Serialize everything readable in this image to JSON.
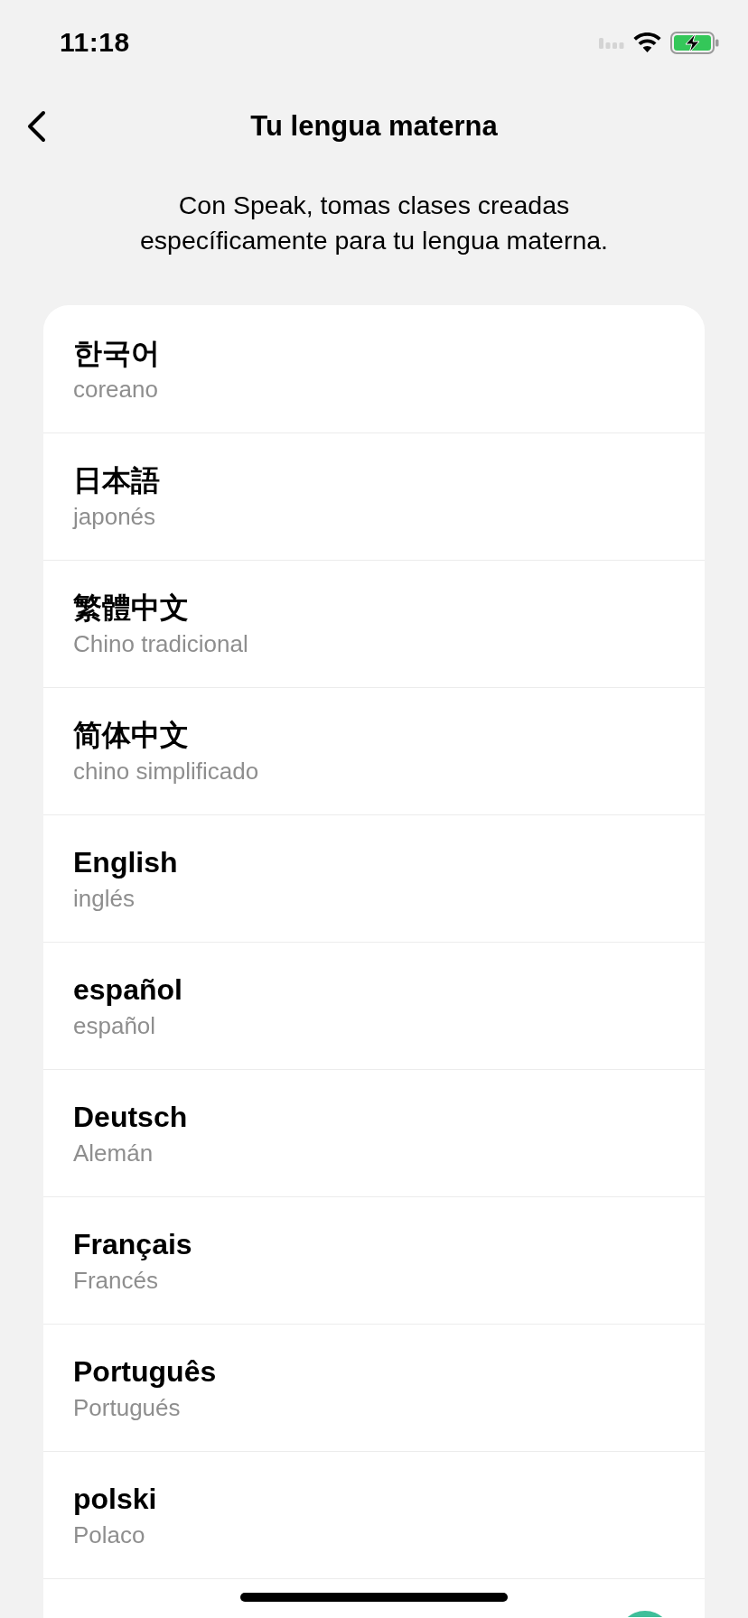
{
  "status_bar": {
    "time": "11:18"
  },
  "nav": {
    "title": "Tu lengua materna"
  },
  "intro": "Con Speak, tomas clases creadas específicamente para tu lengua materna.",
  "languages": [
    {
      "name": "한국어",
      "translation": "coreano",
      "selected": false
    },
    {
      "name": "日本語",
      "translation": "japonés",
      "selected": false
    },
    {
      "name": "繁體中文",
      "translation": "Chino tradicional",
      "selected": false
    },
    {
      "name": "简体中文",
      "translation": "chino simplificado",
      "selected": false
    },
    {
      "name": "English",
      "translation": "inglés",
      "selected": false
    },
    {
      "name": "español",
      "translation": "español",
      "selected": false
    },
    {
      "name": "Deutsch",
      "translation": "Alemán",
      "selected": false
    },
    {
      "name": "Français",
      "translation": "Francés",
      "selected": false
    },
    {
      "name": "Português",
      "translation": "Portugués",
      "selected": false
    },
    {
      "name": "polski",
      "translation": "Polaco",
      "selected": false
    },
    {
      "selected": true
    }
  ]
}
